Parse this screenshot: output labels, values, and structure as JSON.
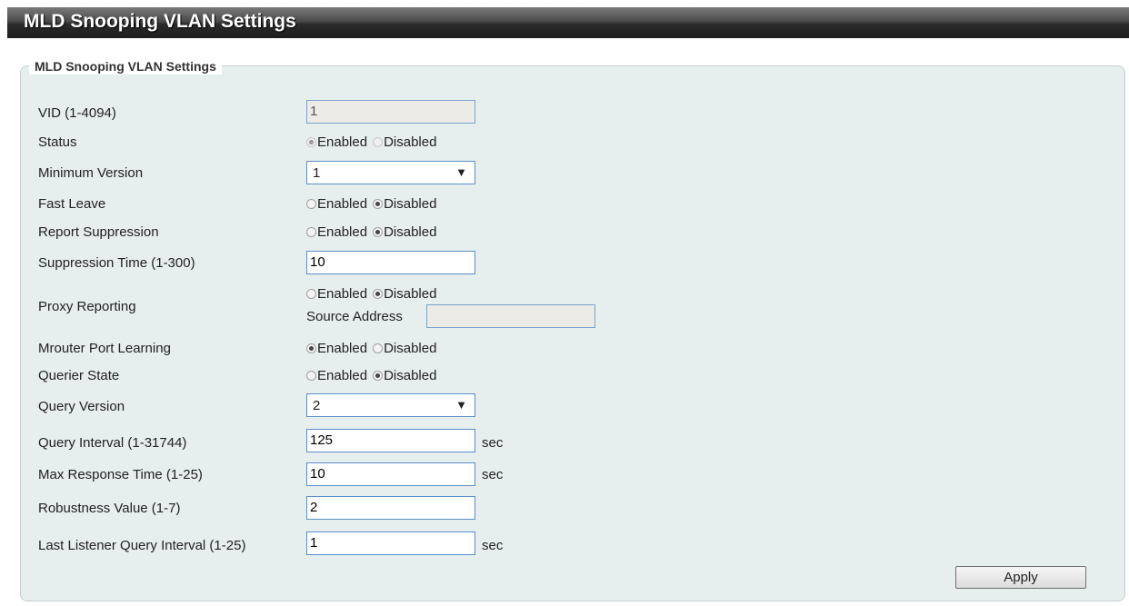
{
  "title": "MLD Snooping VLAN Settings",
  "section_legend": "MLD Snooping VLAN Settings",
  "enabled_label": "Enabled",
  "disabled_label": "Disabled",
  "sec_label": "sec",
  "vid": {
    "label": "VID (1-4094)",
    "value": "1"
  },
  "status": {
    "label": "Status",
    "selected": "Enabled",
    "disabled": true
  },
  "minimum_version": {
    "label": "Minimum Version",
    "value": "1"
  },
  "fast_leave": {
    "label": "Fast Leave",
    "selected": "Disabled"
  },
  "report_suppression": {
    "label": "Report Suppression",
    "selected": "Disabled"
  },
  "suppression_time": {
    "label": "Suppression Time (1-300)",
    "value": "10"
  },
  "proxy_reporting": {
    "label": "Proxy Reporting",
    "selected": "Disabled",
    "source_address_label": "Source Address",
    "source_address_value": ""
  },
  "mrouter_port_learning": {
    "label": "Mrouter Port Learning",
    "selected": "Enabled"
  },
  "querier_state": {
    "label": "Querier State",
    "selected": "Disabled"
  },
  "query_version": {
    "label": "Query Version",
    "value": "2"
  },
  "query_interval": {
    "label": "Query Interval (1-31744)",
    "value": "125"
  },
  "max_response_time": {
    "label": "Max Response Time (1-25)",
    "value": "10"
  },
  "robustness_value": {
    "label": "Robustness Value (1-7)",
    "value": "2"
  },
  "last_listener_query_interval": {
    "label": "Last Listener Query Interval (1-25)",
    "value": "1"
  },
  "apply_label": "Apply"
}
